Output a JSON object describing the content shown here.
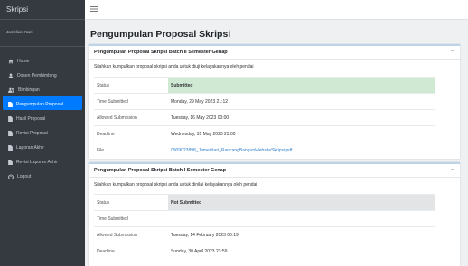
{
  "app": {
    "brand": "Skripsi",
    "user_name": "Jameliani Nari"
  },
  "sidebar": {
    "items": [
      {
        "label": "Home",
        "icon": "home-icon",
        "active": false
      },
      {
        "label": "Dosen Pembimbing",
        "icon": "user-icon",
        "active": false
      },
      {
        "label": "Bimbingan",
        "icon": "users-icon",
        "active": false
      },
      {
        "label": "Pengumpulan Proposal",
        "icon": "file-icon",
        "active": true
      },
      {
        "label": "Hasil Proposal",
        "icon": "file-icon",
        "active": false
      },
      {
        "label": "Revisi Proposal",
        "icon": "file-icon",
        "active": false
      },
      {
        "label": "Laporan Akhir",
        "icon": "file-icon",
        "active": false
      },
      {
        "label": "Revisi Laporan Akhir",
        "icon": "file-icon",
        "active": false
      },
      {
        "label": "Logout",
        "icon": "power-icon",
        "active": false
      }
    ]
  },
  "topbar": {
    "menu_icon": "hamburger-icon"
  },
  "page": {
    "title": "Pengumpulan Proposal Skripsi"
  },
  "cards": [
    {
      "title": "Pengumpulan Proposal Skripsi Batch II Semester Genap",
      "collapse_symbol": "–",
      "description": "Silahkan kumpulkan proposal skripsi anda untuk diuji kelayakannya oleh pendai",
      "rows": [
        {
          "label": "Status",
          "value": "Submitted"
        },
        {
          "label": "Time Submitted",
          "value": "Monday, 29 May 2023 21:12"
        },
        {
          "label": "Allowed Submission",
          "value": "Tuesday, 16 May 2023 00:00"
        },
        {
          "label": "Deadline",
          "value": "Wednesday, 31 May 2023 23:00"
        },
        {
          "label": "File",
          "value": "0909023898_JameiNari_RancangBangunWebsiteSkripsi.pdf"
        }
      ],
      "status_color": "#cfe9d3"
    },
    {
      "title": "Pengumpulan Proposal Skripsi Batch I Semester Genap",
      "collapse_symbol": "–",
      "description": "Silahkan kumpulkan proposal skripsi anda untuk dinilai kelayakannya oleh pendai",
      "rows": [
        {
          "label": "Status",
          "value": "Not Submitted"
        },
        {
          "label": "Time Submitted",
          "value": ""
        },
        {
          "label": "Allowed Submission",
          "value": "Tuesday, 14 February 2023 06:19"
        },
        {
          "label": "Deadline",
          "value": "Sunday, 30 April 2023 23:59"
        }
      ],
      "status_color": "#e2e4e6"
    }
  ]
}
